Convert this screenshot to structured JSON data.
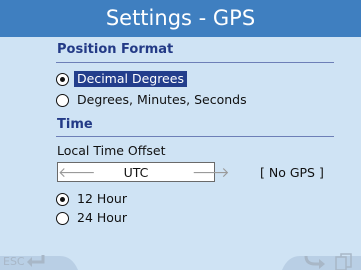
{
  "title": "Settings - GPS",
  "position_format": {
    "heading": "Position Format",
    "options": [
      {
        "label": "Decimal Degrees",
        "checked": true
      },
      {
        "label": "Degrees, Minutes, Seconds",
        "checked": false
      }
    ]
  },
  "time": {
    "heading": "Time",
    "offset_label": "Local Time Offset",
    "offset_value": "UTC",
    "gps_status": "[ No GPS ]",
    "format_options": [
      {
        "label": "12 Hour",
        "checked": true
      },
      {
        "label": "24 Hour",
        "checked": false
      }
    ]
  },
  "bottom": {
    "esc_label": "ESC"
  },
  "icons": {
    "left_arrow": "arrow-left-icon",
    "right_arrow": "arrow-right-icon",
    "esc": "return-arrow-icon",
    "ok": "curved-arrow-icon",
    "copy": "copy-pages-icon"
  },
  "colors": {
    "title_bar": "#3f7fc0",
    "background": "#cfe3f4",
    "heading_text": "#233a86",
    "selection": "#233e8c"
  }
}
